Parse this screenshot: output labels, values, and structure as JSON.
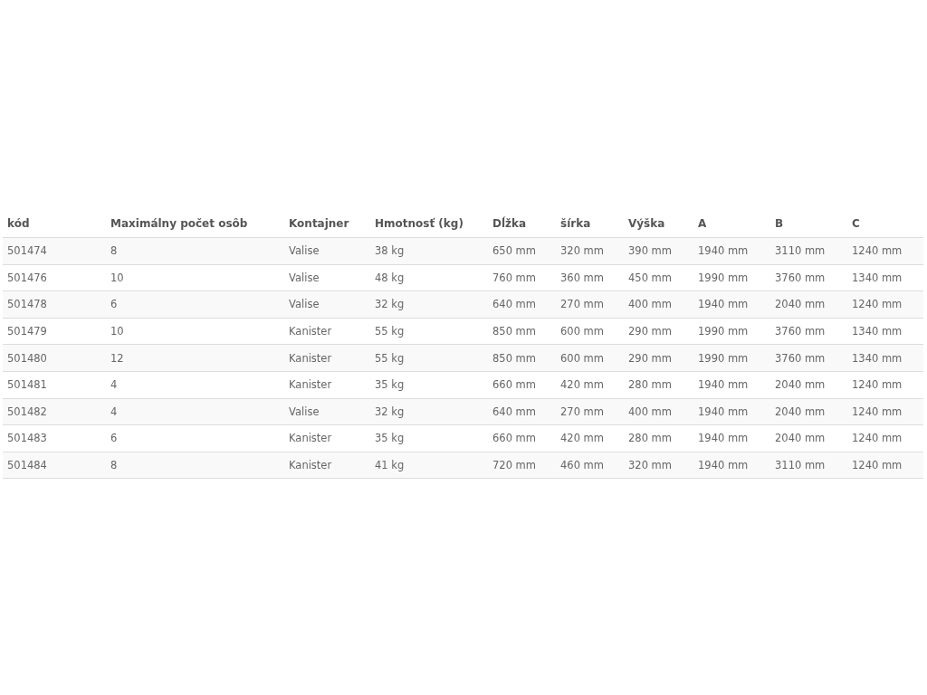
{
  "table": {
    "columns": [
      "kód",
      "Maximálny počet osôb",
      "Kontajner",
      "Hmotnosť (kg)",
      "Dĺžka",
      "šírka",
      "Výška",
      "A",
      "B",
      "C"
    ],
    "rows": [
      [
        "501474",
        "8",
        "Valise",
        "38 kg",
        "650 mm",
        "320 mm",
        "390 mm",
        "1940 mm",
        "3110 mm",
        "1240 mm"
      ],
      [
        "501476",
        "10",
        "Valise",
        "48 kg",
        "760 mm",
        "360 mm",
        "450 mm",
        "1990 mm",
        "3760 mm",
        "1340 mm"
      ],
      [
        "501478",
        "6",
        "Valise",
        "32 kg",
        "640 mm",
        "270 mm",
        "400 mm",
        "1940 mm",
        "2040 mm",
        "1240 mm"
      ],
      [
        "501479",
        "10",
        "Kanister",
        "55 kg",
        "850 mm",
        "600 mm",
        "290 mm",
        "1990 mm",
        "3760 mm",
        "1340 mm"
      ],
      [
        "501480",
        "12",
        "Kanister",
        "55 kg",
        "850 mm",
        "600 mm",
        "290 mm",
        "1990 mm",
        "3760 mm",
        "1340 mm"
      ],
      [
        "501481",
        "4",
        "Kanister",
        "35 kg",
        "660 mm",
        "420 mm",
        "280 mm",
        "1940 mm",
        "2040 mm",
        "1240 mm"
      ],
      [
        "501482",
        "4",
        "Valise",
        "32 kg",
        "640 mm",
        "270 mm",
        "400 mm",
        "1940 mm",
        "2040 mm",
        "1240 mm"
      ],
      [
        "501483",
        "6",
        "Kanister",
        "35 kg",
        "660 mm",
        "420 mm",
        "280 mm",
        "1940 mm",
        "2040 mm",
        "1240 mm"
      ],
      [
        "501484",
        "8",
        "Kanister",
        "41 kg",
        "720 mm",
        "460 mm",
        "320 mm",
        "1940 mm",
        "3110 mm",
        "1240 mm"
      ]
    ]
  }
}
